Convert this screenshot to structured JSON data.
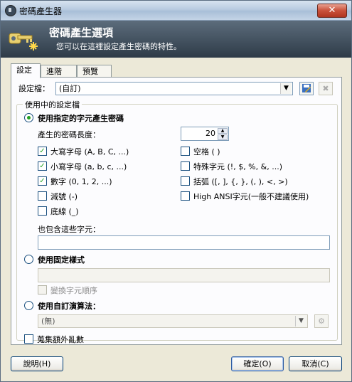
{
  "window": {
    "title": "密碼產生器",
    "close_label": "✕"
  },
  "banner": {
    "title": "密碼產生選項",
    "subtitle": "您可以在這裡設定產生密碼的特性。"
  },
  "tabs": [
    {
      "label": "設定"
    },
    {
      "label": "進階"
    },
    {
      "label": "預覽"
    }
  ],
  "profile": {
    "label": "設定檔：",
    "value": "(自訂)"
  },
  "group": {
    "legend": "使用中的設定檔"
  },
  "charset_mode": {
    "label": "使用指定的字元產生密碼",
    "length_label": "產生的密碼長度：",
    "length_value": "20"
  },
  "charsets": {
    "upper": "大寫字母 (A, B, C, ...)",
    "lower": "小寫字母 (a, b, c, ...)",
    "digits": "數字 (0, 1, 2, ...)",
    "minus": "減號 (-)",
    "underline": "底線 (_)",
    "space": "空格 ( )",
    "special": "特殊字元 (!, $, %, &, ...)",
    "brackets": "括弧 ([, ], {, }, (, ), <, >)",
    "highansi": "High ANSI字元(一般不建議使用)"
  },
  "also_include": {
    "label": "也包含這些字元：",
    "value": ""
  },
  "pattern_mode": {
    "label": "使用固定樣式",
    "permute_label": "變換字元順序"
  },
  "custom_algo": {
    "label": "使用自訂演算法：",
    "value": "(無)"
  },
  "entropy": {
    "label": "蒐集額外亂數"
  },
  "buttons": {
    "help": "說明(H)",
    "ok": "確定(O)",
    "cancel": "取消(C)"
  }
}
